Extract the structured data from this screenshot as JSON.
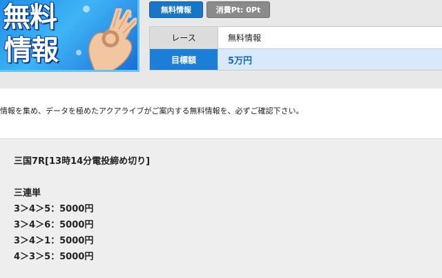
{
  "logo": {
    "line1": "無料",
    "line2": "情報"
  },
  "badges": {
    "free_info": "無料情報",
    "points": "消費Pt: 0Pt"
  },
  "info_table": {
    "race_label": "レース",
    "race_value": "無料情報",
    "target_label": "目標額",
    "target_value": "5万円"
  },
  "description": "情報を集め、データを極めたアクアライブがご案内する無料情報を、必ずご確認下さい。",
  "prediction": {
    "race": "三国7R[13時14分電投締め切り]",
    "bet_type": "三連単",
    "bets": [
      "3＞4＞5：5000円",
      "3＞4＞6：5000円",
      "3＞4＞1：5000円",
      "4＞3＞5：5000円"
    ]
  },
  "colors": {
    "accent_blue": "#1c7ed6",
    "target_bg": "#d7e9fb",
    "badge_gray": "#8a8a8a"
  }
}
